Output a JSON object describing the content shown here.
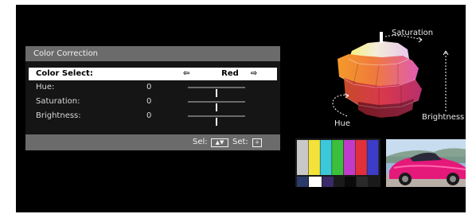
{
  "panel": {
    "title": "Color Correction",
    "rows": [
      {
        "label": "Color Select:",
        "value": "Red",
        "left_arrow": "⇦",
        "right_arrow": "⇨"
      },
      {
        "label": "Hue:",
        "value": "0",
        "level": 0.5
      },
      {
        "label": "Saturation:",
        "value": "0",
        "level": 0.5
      },
      {
        "label": "Brightness:",
        "value": "0",
        "level": 0.5
      }
    ],
    "footer": {
      "sel_label": "Sel:",
      "sel_key": "▲▼",
      "set_label": "Set:",
      "set_key": "+"
    }
  },
  "diagram": {
    "labels": {
      "saturation": "Saturation",
      "hue": "Hue",
      "brightness": "Brightness"
    }
  },
  "colors": {
    "panel_title_bg": "#6b6b6b",
    "panel_bg": "#151515",
    "selected_bg": "#ffffff",
    "test_bars": [
      "#c8c8c8",
      "#f2e23a",
      "#3cc8d8",
      "#3cbf3c",
      "#c03cc8",
      "#e0303c",
      "#3c3cc8"
    ],
    "car_body": "#e4197a"
  }
}
